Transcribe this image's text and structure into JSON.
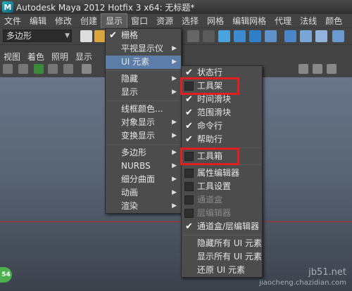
{
  "window": {
    "title": "Autodesk Maya 2012 Hotfix 3 x64: 无标题*",
    "app_icon": "maya-logo-icon"
  },
  "menubar": [
    "文件",
    "编辑",
    "修改",
    "创建",
    "显示",
    "窗口",
    "资源",
    "选择",
    "网格",
    "编辑网格",
    "代理",
    "法线",
    "颜色"
  ],
  "menubar_active": "显示",
  "toolbar": {
    "mode_select": "多边形"
  },
  "panel_menu": [
    "视图",
    "着色",
    "照明",
    "显示"
  ],
  "display_menu": [
    {
      "label": "栅格",
      "checked": true,
      "submenu": false
    },
    {
      "label": "平视显示仪",
      "submenu": true
    },
    {
      "label": "UI 元素",
      "submenu": true,
      "highlighted": true
    },
    {
      "sep": true
    },
    {
      "label": "隐藏",
      "submenu": true
    },
    {
      "label": "显示",
      "submenu": true
    },
    {
      "sep": true
    },
    {
      "label": "线框颜色...",
      "submenu": false
    },
    {
      "label": "对象显示",
      "submenu": true
    },
    {
      "label": "变换显示",
      "submenu": true
    },
    {
      "sep": true
    },
    {
      "label": "多边形",
      "submenu": true
    },
    {
      "label": "NURBS",
      "submenu": true
    },
    {
      "label": "细分曲面",
      "submenu": true
    },
    {
      "label": "动画",
      "submenu": true
    },
    {
      "label": "渲染",
      "submenu": true
    }
  ],
  "ui_elements_menu": [
    {
      "label": "状态行",
      "checked": true
    },
    {
      "label": "工具架",
      "checked": false,
      "boxed": true
    },
    {
      "label": "时间滑块",
      "checked": true
    },
    {
      "label": "范围滑块",
      "checked": true
    },
    {
      "label": "命令行",
      "checked": true
    },
    {
      "label": "帮助行",
      "checked": true
    },
    {
      "sep": true
    },
    {
      "label": "工具箱",
      "checked": false,
      "boxed": true
    },
    {
      "sep": true
    },
    {
      "label": "属性编辑器",
      "checked": false
    },
    {
      "label": "工具设置",
      "checked": false
    },
    {
      "label": "通道盒",
      "checked": false,
      "disabled": true
    },
    {
      "label": "层编辑器",
      "checked": false,
      "disabled": true
    },
    {
      "label": "通道盒/层编辑器",
      "checked": true
    },
    {
      "sep": true
    },
    {
      "label": "隐藏所有 UI 元素"
    },
    {
      "label": "显示所有 UI 元素"
    },
    {
      "label": "还原 UI 元素"
    }
  ],
  "viewport": {
    "badge": "54",
    "watermark_line1": "jb51.net",
    "watermark_line2": "jiaocheng.chazidian.com"
  },
  "colors": {
    "highlight": "#5b7da8",
    "red_box": "#e02020",
    "horizon": "#b02828"
  }
}
